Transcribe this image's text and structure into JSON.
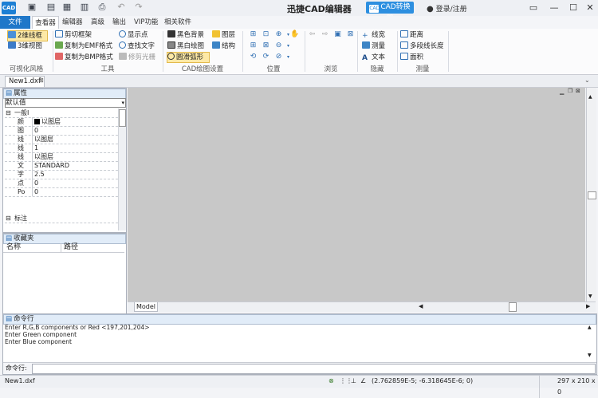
{
  "titlebar": {
    "app_logo": "CAD",
    "title": "迅捷CAD编辑器",
    "converter_label": "CAD转换器",
    "converter_icon_text": "CAD",
    "user_label": "登录/注册"
  },
  "menu": {
    "items": [
      "文件",
      "查看器",
      "编辑器",
      "高级",
      "输出",
      "VIP功能",
      "相关软件"
    ]
  },
  "ribbon": {
    "visual_style": {
      "wireframe_2d": "2维线框",
      "view_3d": "3维视图",
      "label": "可视化风格"
    },
    "tools": {
      "clip_frame": "剪切框架",
      "copy_emf": "复制为EMF格式",
      "copy_bmp": "复制为BMP格式",
      "show_points": "显示点",
      "find_text": "查找文字",
      "trim_raster": "修剪光栅",
      "label": "工具"
    },
    "cad_settings": {
      "black_bg": "黑色背景",
      "bw_drawing": "黑白绘图",
      "smooth_arc": "圆滑弧形",
      "layers": "图层",
      "structure": "结构",
      "label": "CAD绘图设置"
    },
    "position_label": "位置",
    "browse_label": "浏览",
    "hide": {
      "line_width": "线宽",
      "measure": "测量",
      "text": "文本",
      "label": "隐藏"
    },
    "measure": {
      "distance": "距离",
      "polyline_length": "多段线长度",
      "area": "面积",
      "label": "测量"
    }
  },
  "document": {
    "tab": "New1.dxf"
  },
  "properties": {
    "title": "属性",
    "selector": "默认值",
    "group_general": "一般I",
    "group_dim": "标注",
    "rows": [
      {
        "key": "颜",
        "value": "以图层",
        "swatch": "#000000"
      },
      {
        "key": "图",
        "value": "0"
      },
      {
        "key": "线",
        "value": "以图层"
      },
      {
        "key": "线",
        "value": "1"
      },
      {
        "key": "线",
        "value": "以图层"
      },
      {
        "key": "文",
        "value": "STANDARD"
      },
      {
        "key": "字",
        "value": "2.5"
      },
      {
        "key": "点",
        "value": "0"
      },
      {
        "key": "Po",
        "value": "0"
      }
    ]
  },
  "favorites": {
    "title": "收藏夹",
    "col_name": "名称",
    "col_path": "路径"
  },
  "canvas": {
    "model_tab": "Model"
  },
  "command": {
    "title": "命令行",
    "lines": [
      "Enter R,G,B components or Red <197,201,204>",
      "Enter Green component",
      "Enter Blue component"
    ],
    "input_label": "命令行:"
  },
  "status": {
    "file": "New1.dxf",
    "coords": "(2.762859E-5; -6.318645E-6; 0)",
    "size": "297 x 210 x 0"
  },
  "colors": {
    "accent": "#1f77c9",
    "canvas_bg": "#c8c8c8"
  }
}
